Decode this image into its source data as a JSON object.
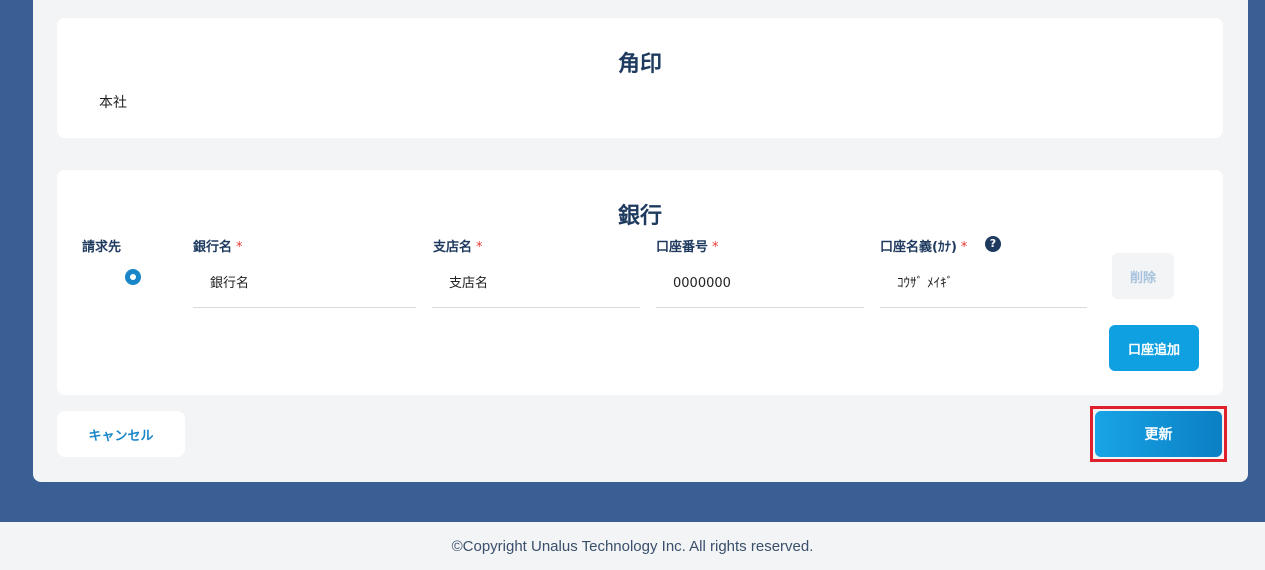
{
  "stamp_section": {
    "title": "角印",
    "value": "本社"
  },
  "bank_section": {
    "title": "銀行",
    "columns": {
      "billing": "請求先",
      "bank_name": "銀行名",
      "branch_name": "支店名",
      "account_number": "口座番号",
      "account_holder": "口座名義(ｶﾅ)"
    },
    "required_mark": "*",
    "help_icon": "?",
    "fields": {
      "bank_name_placeholder": "銀行名",
      "branch_name_placeholder": "支店名",
      "account_number_placeholder": "0000000",
      "account_holder_placeholder": "ｺｳｻﾞ ﾒｲｷﾞ"
    },
    "delete_label": "削除",
    "add_account_label": "口座追加"
  },
  "actions": {
    "cancel_label": "キャンセル",
    "update_label": "更新"
  },
  "footer": {
    "copyright": "©Copyright Unalus Technology Inc. All rights reserved."
  },
  "colors": {
    "page_bg": "#3a5f94",
    "panel_bg": "#f3f4f6",
    "primary": "#0fa0e2",
    "highlight": "#e0202a",
    "heading": "#1e3a5f"
  }
}
